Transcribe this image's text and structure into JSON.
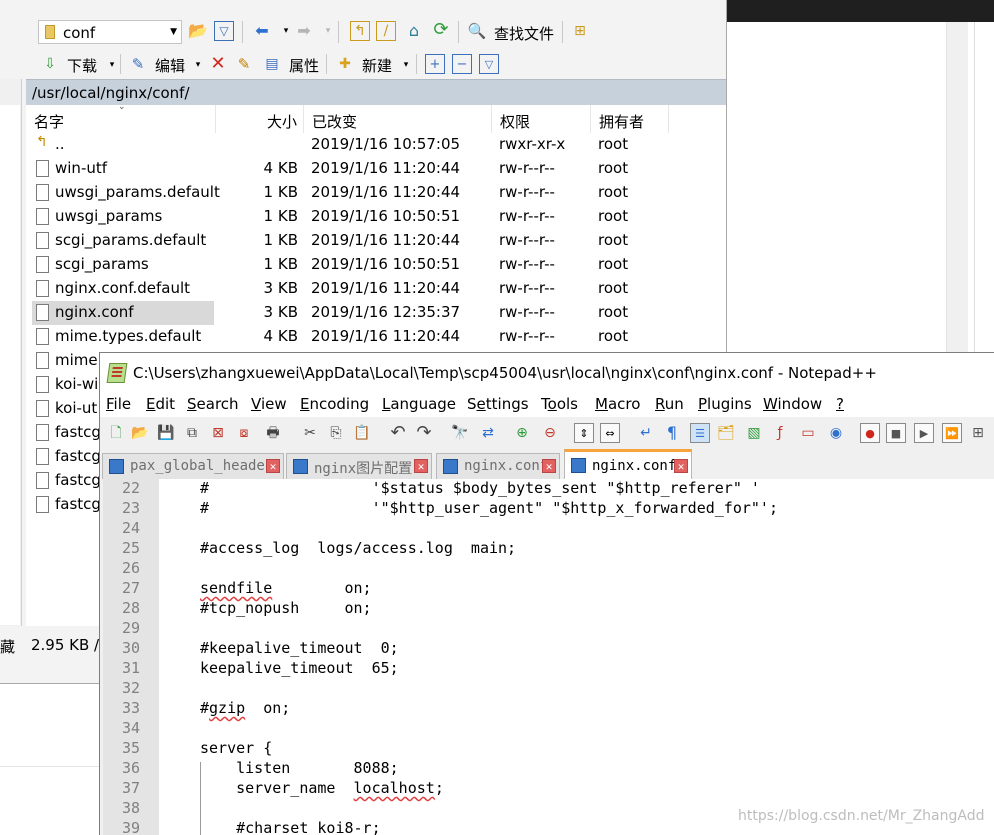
{
  "winscp": {
    "path_combo": "conf",
    "find_files": "查找文件",
    "toolbar2": {
      "download": "下载",
      "edit": "编辑",
      "properties": "属性",
      "new": "新建"
    },
    "path": "/usr/local/nginx/conf/",
    "columns": {
      "name": "名字",
      "size": "大小",
      "modified": "已改变",
      "rights": "权限",
      "owner": "拥有者"
    },
    "files": [
      {
        "name": "..",
        "size": "",
        "modified": "2019/1/16 10:57:05",
        "rights": "rwxr-xr-x",
        "owner": "root"
      },
      {
        "name": "win-utf",
        "size": "4 KB",
        "modified": "2019/1/16 11:20:44",
        "rights": "rw-r--r--",
        "owner": "root"
      },
      {
        "name": "uwsgi_params.default",
        "size": "1 KB",
        "modified": "2019/1/16 11:20:44",
        "rights": "rw-r--r--",
        "owner": "root"
      },
      {
        "name": "uwsgi_params",
        "size": "1 KB",
        "modified": "2019/1/16 10:50:51",
        "rights": "rw-r--r--",
        "owner": "root"
      },
      {
        "name": "scgi_params.default",
        "size": "1 KB",
        "modified": "2019/1/16 11:20:44",
        "rights": "rw-r--r--",
        "owner": "root"
      },
      {
        "name": "scgi_params",
        "size": "1 KB",
        "modified": "2019/1/16 10:50:51",
        "rights": "rw-r--r--",
        "owner": "root"
      },
      {
        "name": "nginx.conf.default",
        "size": "3 KB",
        "modified": "2019/1/16 11:20:44",
        "rights": "rw-r--r--",
        "owner": "root"
      },
      {
        "name": "nginx.conf",
        "size": "3 KB",
        "modified": "2019/1/16 12:35:37",
        "rights": "rw-r--r--",
        "owner": "root"
      },
      {
        "name": "mime.types.default",
        "size": "4 KB",
        "modified": "2019/1/16 11:20:44",
        "rights": "rw-r--r--",
        "owner": "root"
      },
      {
        "name": "mime.",
        "size": "",
        "modified": "",
        "rights": "",
        "owner": ""
      },
      {
        "name": "koi-wi",
        "size": "",
        "modified": "",
        "rights": "",
        "owner": ""
      },
      {
        "name": "koi-ut",
        "size": "",
        "modified": "",
        "rights": "",
        "owner": ""
      },
      {
        "name": "fastcg",
        "size": "",
        "modified": "",
        "rights": "",
        "owner": ""
      },
      {
        "name": "fastcg",
        "size": "",
        "modified": "",
        "rights": "",
        "owner": ""
      },
      {
        "name": "fastcg",
        "size": "",
        "modified": "",
        "rights": "",
        "owner": ""
      },
      {
        "name": "fastcg",
        "size": "",
        "modified": "",
        "rights": "",
        "owner": ""
      }
    ],
    "status_left": "藏",
    "status_size": "2.95 KB /"
  },
  "notepad": {
    "title": "C:\\Users\\zhangxuewei\\AppData\\Local\\Temp\\scp45004\\usr\\local\\nginx\\conf\\nginx.conf - Notepad++",
    "menu": [
      "File",
      "Edit",
      "Search",
      "View",
      "Encoding",
      "Language",
      "Settings",
      "Tools",
      "Macro",
      "Run",
      "Plugins",
      "Window",
      "?"
    ],
    "tabs": [
      "pax_global_header",
      "nginx图片配置",
      "nginx.conf",
      "nginx.conf"
    ],
    "lines": [
      {
        "n": "22",
        "t": "    #                  '$status $body_bytes_sent \"$http_referer\" '"
      },
      {
        "n": "23",
        "t": "    #                  '\"$http_user_agent\" \"$http_x_forwarded_for\"';"
      },
      {
        "n": "24",
        "t": ""
      },
      {
        "n": "25",
        "t": "    #access_log  logs/access.log  main;"
      },
      {
        "n": "26",
        "t": ""
      },
      {
        "n": "27",
        "t": "    sendfile        on;"
      },
      {
        "n": "28",
        "t": "    #tcp_nopush     on;"
      },
      {
        "n": "29",
        "t": ""
      },
      {
        "n": "30",
        "t": "    #keepalive_timeout  0;"
      },
      {
        "n": "31",
        "t": "    keepalive_timeout  65;"
      },
      {
        "n": "32",
        "t": ""
      },
      {
        "n": "33",
        "t": "    #gzip  on;"
      },
      {
        "n": "34",
        "t": ""
      },
      {
        "n": "35",
        "t": "    server {"
      },
      {
        "n": "36",
        "t": "        listen       8088;"
      },
      {
        "n": "37",
        "t": "        server_name  localhost;"
      },
      {
        "n": "38",
        "t": ""
      },
      {
        "n": "39",
        "t": "        #charset koi8-r;"
      }
    ]
  },
  "watermark": "https://blog.csdn.net/Mr_ZhangAdd"
}
